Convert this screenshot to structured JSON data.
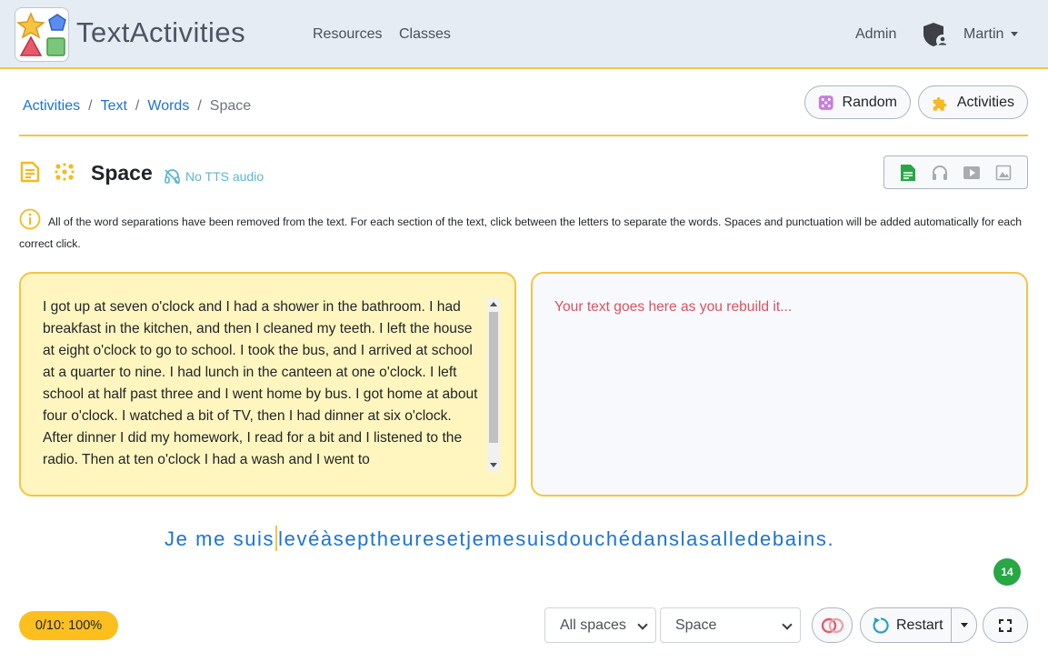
{
  "brand": {
    "name": "TextActivities"
  },
  "nav": {
    "links": [
      "Resources",
      "Classes"
    ],
    "admin": "Admin",
    "user": "Martin"
  },
  "breadcrumb": {
    "items": [
      "Activities",
      "Text",
      "Words"
    ],
    "current": "Space",
    "separator": "/"
  },
  "actions": {
    "random": "Random",
    "activities": "Activities"
  },
  "activity": {
    "title": "Space",
    "tts_status": "No TTS audio",
    "instructions": "All of the word separations have been removed from the text. For each section of the text, click between the letters to separate the words. Spaces and punctuation will be added automatically for each correct click."
  },
  "source_text": "I got up at seven o'clock and I had a shower in the bathroom. I had breakfast in the kitchen, and then I cleaned my teeth. I left the house at eight o'clock to go to school. I took the bus, and I arrived at school at a quarter to nine. I had lunch in the canteen at one o'clock. I left school at half past three and I went home by bus. I got home at about four o'clock. I watched a bit of TV, then I had dinner at six o'clock. After dinner I did my homework, I read for a bit and I listened to the radio. Then at ten o'clock I had a wash and I went to",
  "rebuild_placeholder": "Your text goes here as you rebuild it...",
  "sentence": {
    "done": "Je me suis",
    "remaining": "levéàseptheuresetjemesuisdouchédanslasalledebains."
  },
  "remaining_count": "14",
  "footer": {
    "score": "0/10: 100%",
    "spaces_select": "All spaces",
    "mode_select": "Space",
    "restart": "Restart"
  },
  "colors": {
    "accent": "#f6c343",
    "link": "#1a73d9",
    "left_panel_bg": "#fff6bf",
    "placeholder": "#d9535f",
    "badge": "#28a745",
    "score_bg": "#fcbf1e"
  },
  "icons": [
    "logo-shapes-icon",
    "user-shield-icon",
    "dice-icon",
    "puzzle-icon",
    "document-icon",
    "dots-icon",
    "headset-off-icon",
    "text-icon",
    "headphones-icon",
    "video-icon",
    "image-icon",
    "info-icon",
    "rings-icon",
    "restart-icon",
    "fullscreen-icon"
  ]
}
